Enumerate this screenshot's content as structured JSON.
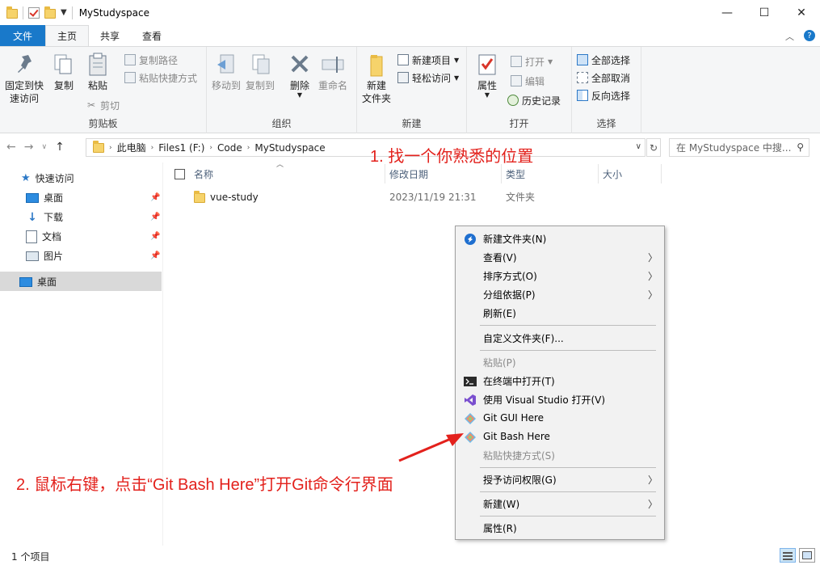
{
  "window": {
    "title": "MyStudyspace",
    "minimize": "—",
    "maximize": "☐",
    "close": "✕"
  },
  "ribbon_tabs": [
    {
      "label": "文件"
    },
    {
      "label": "主页"
    },
    {
      "label": "共享"
    },
    {
      "label": "查看"
    }
  ],
  "ribbon": {
    "clipboard": {
      "group_label": "剪贴板",
      "pin_label_1": "固定到快",
      "pin_label_2": "速访问",
      "copy": "复制",
      "paste": "粘贴",
      "copy_path": "复制路径",
      "paste_shortcut": "粘贴快捷方式",
      "cut": "剪切"
    },
    "organize": {
      "group_label": "组织",
      "move_to": "移动到",
      "copy_to": "复制到",
      "delete": "删除",
      "rename": "重命名"
    },
    "new": {
      "group_label": "新建",
      "new_folder_1": "新建",
      "new_folder_2": "文件夹",
      "new_item": "新建项目",
      "easy_access": "轻松访问"
    },
    "open": {
      "group_label": "打开",
      "properties": "属性",
      "open": "打开",
      "edit": "编辑",
      "history": "历史记录"
    },
    "select": {
      "group_label": "选择",
      "select_all": "全部选择",
      "select_none": "全部取消",
      "invert": "反向选择"
    }
  },
  "address": {
    "breadcrumbs": [
      "此电脑",
      "Files1 (F:)",
      "Code",
      "MyStudyspace"
    ],
    "search_placeholder": "在 MyStudyspace 中搜..."
  },
  "nav": {
    "quick_access": "快速访问",
    "items": [
      {
        "label": "桌面"
      },
      {
        "label": "下载"
      },
      {
        "label": "文档"
      },
      {
        "label": "图片"
      }
    ],
    "desktop": "桌面"
  },
  "columns": {
    "name": "名称",
    "modified": "修改日期",
    "type": "类型",
    "size": "大小"
  },
  "files": [
    {
      "name": "vue-study",
      "modified": "2023/11/19 21:31",
      "type": "文件夹",
      "size": ""
    }
  ],
  "context_menu": {
    "items": [
      {
        "label": "新建文件夹(N)",
        "disabled": false,
        "submenu": false
      },
      {
        "label": "查看(V)",
        "disabled": false,
        "submenu": true
      },
      {
        "label": "排序方式(O)",
        "disabled": false,
        "submenu": true
      },
      {
        "label": "分组依据(P)",
        "disabled": false,
        "submenu": true
      },
      {
        "label": "刷新(E)",
        "disabled": false,
        "submenu": false
      },
      {
        "label": "自定义文件夹(F)...",
        "disabled": false,
        "submenu": false
      },
      {
        "label": "粘贴(P)",
        "disabled": true,
        "submenu": false
      },
      {
        "label": "在终端中打开(T)",
        "disabled": false,
        "submenu": false
      },
      {
        "label": "使用 Visual Studio 打开(V)",
        "disabled": false,
        "submenu": false
      },
      {
        "label": "Git GUI Here",
        "disabled": false,
        "submenu": false
      },
      {
        "label": "Git Bash Here",
        "disabled": false,
        "submenu": false
      },
      {
        "label": "粘贴快捷方式(S)",
        "disabled": true,
        "submenu": false
      },
      {
        "label": "授予访问权限(G)",
        "disabled": false,
        "submenu": true
      },
      {
        "label": "新建(W)",
        "disabled": false,
        "submenu": true
      },
      {
        "label": "属性(R)",
        "disabled": false,
        "submenu": false
      }
    ]
  },
  "annotations": {
    "step1": "1. 找一个你熟悉的位置",
    "step2": "2. 鼠标右键，点击“Git Bash Here”打开Git命令行界面"
  },
  "status": {
    "count": "1 个项目"
  },
  "colors": {
    "accent": "#1979ca",
    "annotation": "#e3211c"
  }
}
